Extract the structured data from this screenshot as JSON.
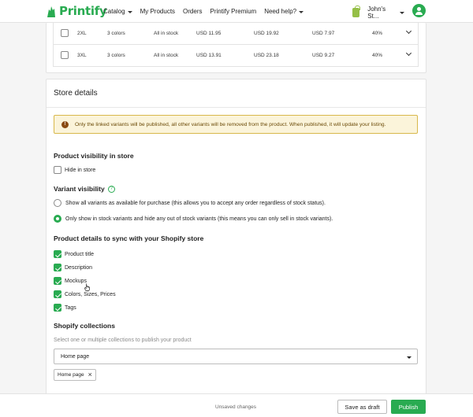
{
  "header": {
    "brand": "Printify",
    "nav": [
      {
        "label": "Catalog",
        "dropdown": true
      },
      {
        "label": "My Products",
        "dropdown": false
      },
      {
        "label": "Orders",
        "dropdown": false
      },
      {
        "label": "Printify Premium",
        "dropdown": false
      },
      {
        "label": "Need help?",
        "dropdown": true
      }
    ],
    "store_name": "John's St...",
    "accent_color": "#29ab51"
  },
  "variants": {
    "rows": [
      {
        "size": "2XL",
        "colors": "3 colors",
        "stock": "All in stock",
        "cost": "USD 11.95",
        "price": "USD 19.92",
        "profit": "USD 7.97",
        "margin": "40%"
      },
      {
        "size": "3XL",
        "colors": "3 colors",
        "stock": "All in stock",
        "cost": "USD 13.91",
        "price": "USD 23.18",
        "profit": "USD 9.27",
        "margin": "40%"
      }
    ]
  },
  "store_details": {
    "title": "Store details",
    "banner": "Only the linked variants will be published, all other variants will be removed from the product. When published, it will update your listing.",
    "visibility": {
      "heading": "Product visibility in store",
      "hide_label": "Hide in store",
      "hide_checked": false
    },
    "variant_visibility": {
      "heading": "Variant visibility",
      "options": [
        {
          "label": "Show all variants as available for purchase (this allows you to accept any order regardless of stock status).",
          "selected": false
        },
        {
          "label": "Only show in stock variants and hide any out of stock variants (this means you can only sell in stock variants).",
          "selected": true
        }
      ]
    },
    "sync": {
      "heading": "Product details to sync with your Shopify store",
      "items": [
        {
          "label": "Product title",
          "checked": true
        },
        {
          "label": "Description",
          "checked": true
        },
        {
          "label": "Mockups",
          "checked": true
        },
        {
          "label": "Colors, Sizes, Prices",
          "checked": true
        },
        {
          "label": "Tags",
          "checked": true
        }
      ]
    },
    "collections": {
      "heading": "Shopify collections",
      "hint": "Select one or multiple collections to publish your product",
      "selected_value": "Home page",
      "chips": [
        "Home page"
      ]
    }
  },
  "footer": {
    "status": "Unsaved changes",
    "draft_label": "Save as draft",
    "publish_label": "Publish"
  }
}
